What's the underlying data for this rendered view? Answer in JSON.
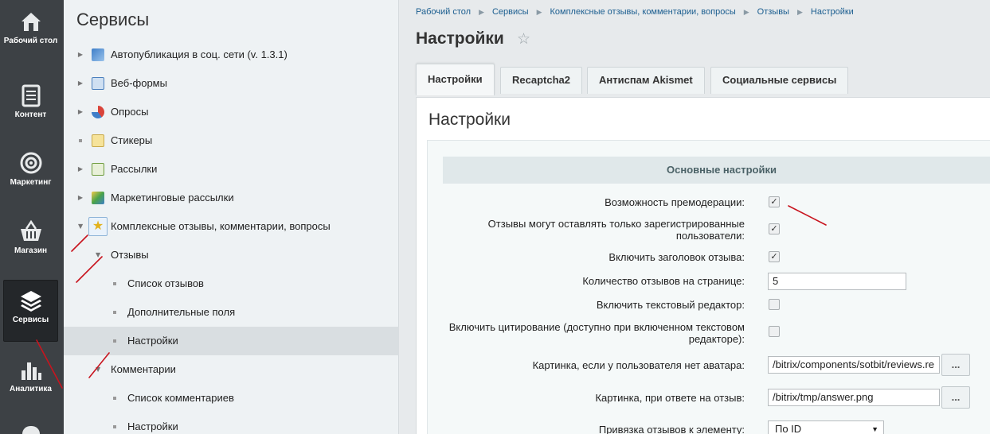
{
  "leftbar": {
    "items": [
      {
        "label": "Рабочий стол",
        "icon": "home-icon"
      },
      {
        "label": "Контент",
        "icon": "document-icon"
      },
      {
        "label": "Маркетинг",
        "icon": "target-icon"
      },
      {
        "label": "Магазин",
        "icon": "basket-icon"
      },
      {
        "label": "Сервисы",
        "icon": "layers-icon"
      },
      {
        "label": "Аналитика",
        "icon": "bar-chart-icon"
      }
    ]
  },
  "tree": {
    "title": "Сервисы",
    "nodes": [
      {
        "label": "Автопубликация в соц. сети (v. 1.3.1)"
      },
      {
        "label": "Веб-формы"
      },
      {
        "label": "Опросы"
      },
      {
        "label": "Стикеры"
      },
      {
        "label": "Рассылки"
      },
      {
        "label": "Маркетинговые рассылки"
      },
      {
        "label": "Комплексные отзывы, комментарии, вопросы"
      },
      {
        "label": "Отзывы"
      },
      {
        "label": "Список отзывов"
      },
      {
        "label": "Дополнительные поля"
      },
      {
        "label": "Настройки"
      },
      {
        "label": "Комментарии"
      },
      {
        "label": "Список комментариев"
      },
      {
        "label": "Настройки"
      }
    ]
  },
  "breadcrumb": [
    "Рабочий стол",
    "Сервисы",
    "Комплексные отзывы, комментарии, вопросы",
    "Отзывы",
    "Настройки"
  ],
  "page": {
    "title": "Настройки",
    "tabs": [
      "Настройки",
      "Recaptcha2",
      "Антиспам Akismet",
      "Социальные сервисы"
    ],
    "panel_title": "Настройки",
    "section_title": "Основные настройки"
  },
  "form": {
    "premoderation_label": "Возможность премодерации:",
    "registered_only_label_1": "Отзывы могут оставлять только зарегистрированные",
    "registered_only_label_2": "пользователи:",
    "title_enable_label": "Включить заголовок отзыва:",
    "per_page_label": "Количество отзывов на странице:",
    "per_page_value": "5",
    "text_editor_label": "Включить текстовый редактор:",
    "quote_label_1": "Включить цитирование (доступно при включенном текстовом",
    "quote_label_2": "редакторе):",
    "avatar_label": "Картинка, если у пользователя нет аватара:",
    "avatar_value": "/bitrix/components/sotbit/reviews.re",
    "answer_label": "Картинка, при ответе на отзыв:",
    "answer_value": "/bitrix/tmp/answer.png",
    "bind_label": "Привязка отзывов к элементу:",
    "bind_value": "По ID",
    "browse_label": "...",
    "checked_mark": "✓"
  },
  "colors": {
    "annotation": "#c8141e",
    "link": "#1a5d8f",
    "sidebar": "#3d4145"
  }
}
